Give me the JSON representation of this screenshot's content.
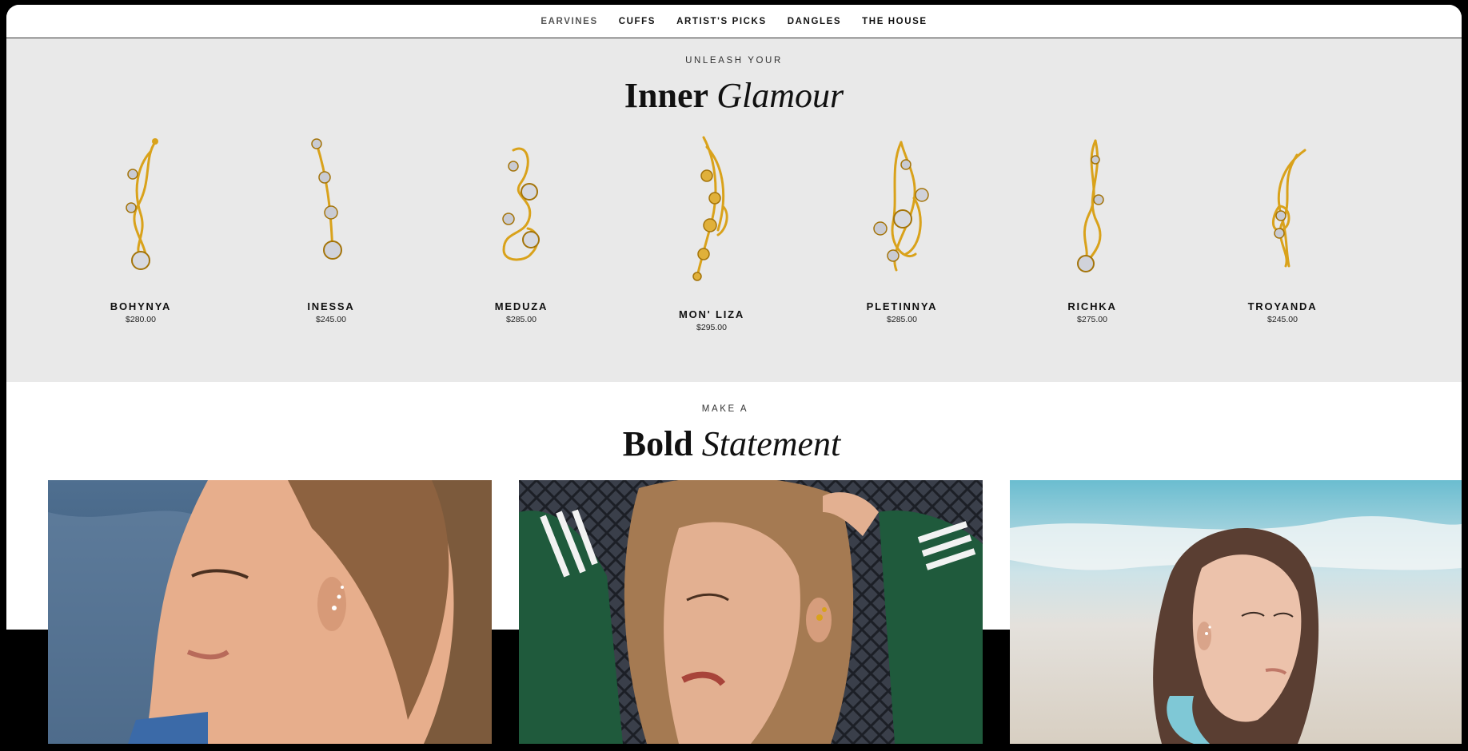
{
  "nav": {
    "items": [
      "EARVINES",
      "CUFFS",
      "ARTIST'S PICKS",
      "DANGLES",
      "THE HOUSE"
    ],
    "active": "EARVINES"
  },
  "glamour": {
    "eyebrow": "UNLEASH YOUR",
    "title_bold": "Inner",
    "title_italic": "Glamour"
  },
  "products": [
    {
      "name": "BOHYNYA",
      "price": "$280.00"
    },
    {
      "name": "INESSA",
      "price": "$245.00"
    },
    {
      "name": "MEDUZA",
      "price": "$285.00"
    },
    {
      "name": "MON' LIZA",
      "price": "$295.00"
    },
    {
      "name": "PLETINNYA",
      "price": "$285.00"
    },
    {
      "name": "RICHKA",
      "price": "$275.00"
    },
    {
      "name": "TROYANDA",
      "price": "$245.00"
    }
  ],
  "statement": {
    "eyebrow": "MAKE A",
    "title_bold": "Bold",
    "title_italic": "Statement"
  },
  "colors": {
    "gold": "#d9a21b",
    "gold_dark": "#a4740a",
    "section_bg": "#e9e9e9"
  }
}
